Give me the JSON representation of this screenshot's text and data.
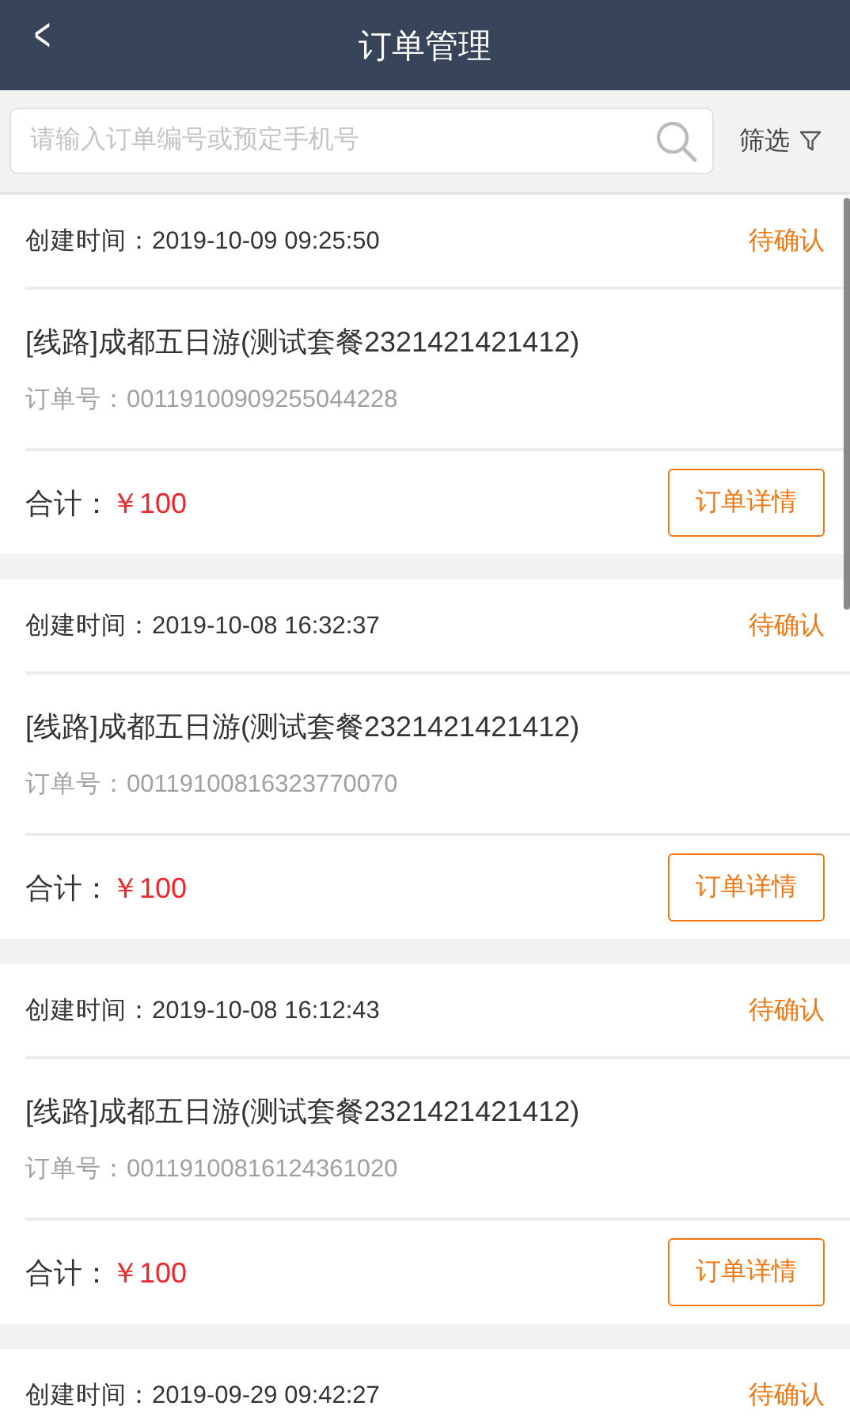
{
  "header": {
    "back": "<",
    "title": "订单管理"
  },
  "search": {
    "placeholder": "请输入订单编号或预定手机号"
  },
  "filter": {
    "label": "筛选"
  },
  "orders": [
    {
      "created": "创建时间：2019-10-09 09:25:50",
      "status": "待确认",
      "title": "[线路]成都五日游(测试套餐2321421421412)",
      "order_no": "订单号：00119100909255044228",
      "total_label": "合计：",
      "total": "￥100",
      "detail_button": "订单详情"
    },
    {
      "created": "创建时间：2019-10-08 16:32:37",
      "status": "待确认",
      "title": "[线路]成都五日游(测试套餐2321421421412)",
      "order_no": "订单号：00119100816323770070",
      "total_label": "合计：",
      "total": "￥100",
      "detail_button": "订单详情"
    },
    {
      "created": "创建时间：2019-10-08 16:12:43",
      "status": "待确认",
      "title": "[线路]成都五日游(测试套餐2321421421412)",
      "order_no": "订单号：00119100816124361020",
      "total_label": "合计：",
      "total": "￥100",
      "detail_button": "订单详情"
    },
    {
      "created": "创建时间：2019-09-29 09:42:27",
      "status": "待确认"
    }
  ]
}
